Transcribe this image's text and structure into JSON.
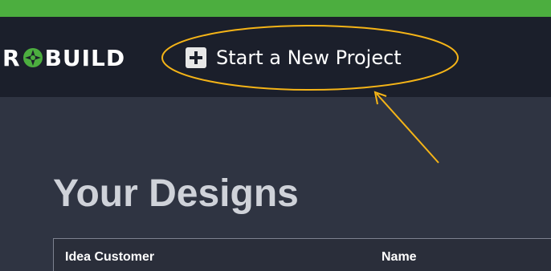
{
  "header": {
    "logo": {
      "text_left": "R",
      "text_right": "BUILD",
      "mark_icon": "gear-star-icon",
      "mark_color": "#4cae3f"
    },
    "new_project": {
      "icon": "plus-square-icon",
      "label": "Start a New Project"
    }
  },
  "main": {
    "title": "Your Designs",
    "table": {
      "columns": [
        "Idea Customer",
        "Name"
      ]
    }
  },
  "colors": {
    "top_strip": "#4cae3f",
    "header_bg": "#1b1f2b",
    "page_bg": "#2f3442",
    "annotation": "#f5b417"
  }
}
